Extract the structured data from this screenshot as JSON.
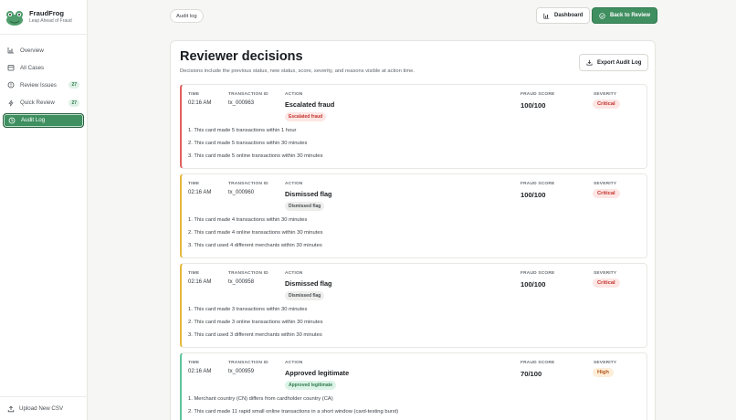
{
  "brand": {
    "name": "FraudFrog",
    "tagline": "Leap Ahead of Fraud"
  },
  "sidebar": {
    "items": [
      {
        "label": "Overview",
        "icon": "chart-icon",
        "badge": null,
        "active": false
      },
      {
        "label": "All Cases",
        "icon": "folder-icon",
        "badge": null,
        "active": false
      },
      {
        "label": "Review Issues",
        "icon": "alert-circle-icon",
        "badge": "27",
        "active": false
      },
      {
        "label": "Quick Review",
        "icon": "lightning-icon",
        "badge": "27",
        "active": false
      },
      {
        "label": "Audit Log",
        "icon": "history-icon",
        "badge": null,
        "active": true
      }
    ],
    "footer": {
      "label": "Upload New CSV",
      "icon": "upload-icon"
    }
  },
  "header": {
    "breadcrumb": "Audit log",
    "dashboard_label": "Dashboard",
    "back_label": "Back to Review"
  },
  "main": {
    "title": "Reviewer decisions",
    "subtitle": "Decisions include the previous status, new status, score, severity, and reasons visible at action time.",
    "export_label": "Export Audit Log",
    "column_labels": {
      "time": "TIME",
      "transaction": "TRANSACTION ID",
      "action": "ACTION",
      "score": "FRAUD SCORE",
      "severity": "SEVERITY"
    },
    "entries": [
      {
        "time": "02:16 AM",
        "transaction_id": "tx_000963",
        "action": "Escalated fraud",
        "status_pill": "Escalated fraud",
        "score": "100/100",
        "severity": "Critical",
        "reasons": [
          "1. This card made 5 transactions within 1 hour",
          "2. This card made 5 transactions within 30 minutes",
          "3. This card made 5 online transactions within 30 minutes"
        ]
      },
      {
        "time": "02:16 AM",
        "transaction_id": "tx_000960",
        "action": "Dismissed flag",
        "status_pill": "Dismissed flag",
        "score": "100/100",
        "severity": "Critical",
        "reasons": [
          "1. This card made 4 transactions within 30 minutes",
          "2. This card made 4 online transactions within 30 minutes",
          "3. This card used 4 different merchants within 30 minutes"
        ]
      },
      {
        "time": "02:16 AM",
        "transaction_id": "tx_000958",
        "action": "Dismissed flag",
        "status_pill": "Dismissed flag",
        "score": "100/100",
        "severity": "Critical",
        "reasons": [
          "1. This card made 3 transactions within 30 minutes",
          "2. This card made 3 online transactions within 30 minutes",
          "3. This card used 3 different merchants within 30 minutes"
        ]
      },
      {
        "time": "02:16 AM",
        "transaction_id": "tx_000959",
        "action": "Approved legitimate",
        "status_pill": "Approved legitimate",
        "score": "70/100",
        "severity": "High",
        "reasons": [
          "1. Merchant country (CN) differs from cardholder country (CA)",
          "2. This card made 11 rapid small online transactions in a short window (card-testing burst)"
        ]
      }
    ]
  },
  "colors": {
    "brand_green": "#3f8f60",
    "escalated_border": "#e0605e",
    "dismissed_border": "#e6b73b",
    "approved_border": "#5cc49a",
    "critical_bg": "#fde6e4",
    "critical_fg": "#c4342f",
    "high_bg": "#fdeed9",
    "high_fg": "#b4561a"
  }
}
